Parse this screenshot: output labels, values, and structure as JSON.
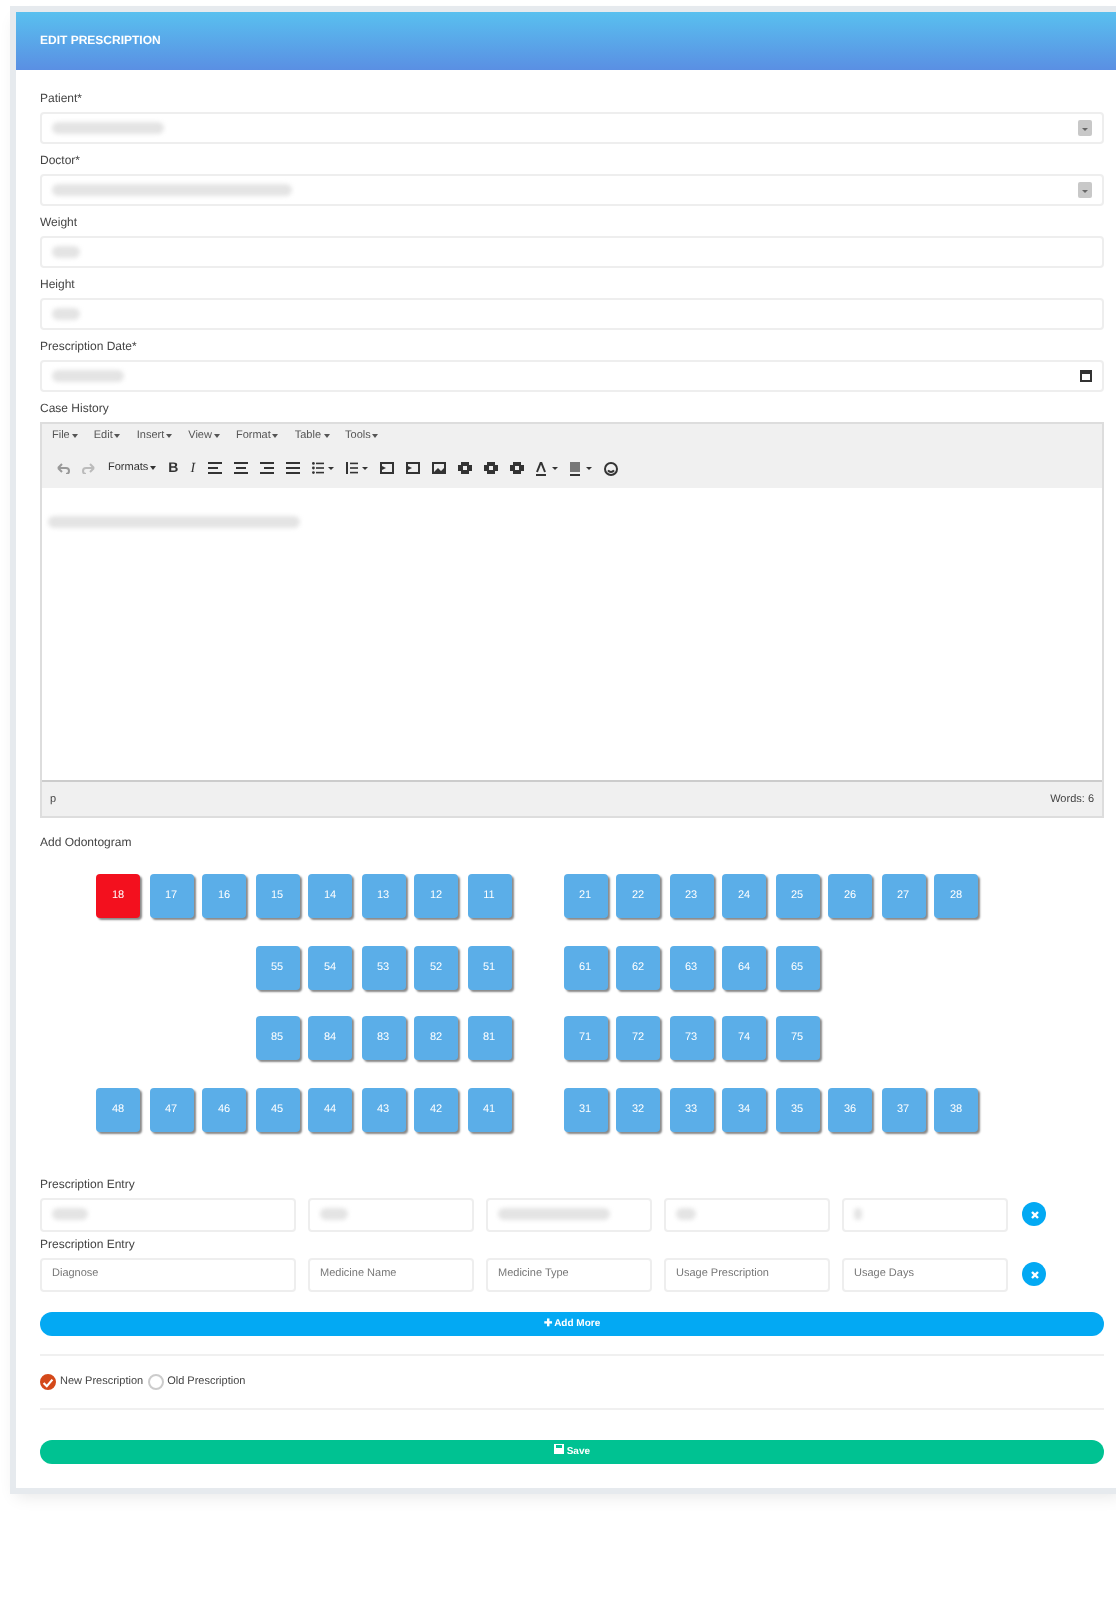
{
  "panel": {
    "title": "EDIT PRESCRIPTION"
  },
  "fields": [
    {
      "label": "Patient*",
      "kind": "select"
    },
    {
      "label": "Doctor*",
      "kind": "select"
    },
    {
      "label": "Weight",
      "kind": "text"
    },
    {
      "label": "Height",
      "kind": "text"
    },
    {
      "label": "Prescription Date*",
      "kind": "date"
    }
  ],
  "editor": {
    "label": "Case History",
    "menus": [
      "File",
      "Edit",
      "Insert",
      "View",
      "Format",
      "Table",
      "Tools"
    ],
    "formats": "Formats",
    "bold": "B",
    "italic": "I",
    "path": "p",
    "word_count": "Words: 6"
  },
  "odontogram": {
    "label": "Add Odontogram",
    "rows": [
      {
        "left": [
          {
            "label": "18",
            "selected": true
          },
          {
            "label": "17",
            "selected": false
          },
          {
            "label": "16",
            "selected": false
          },
          {
            "label": "15",
            "selected": false
          },
          {
            "label": "14",
            "selected": false
          },
          {
            "label": "13",
            "selected": false
          },
          {
            "label": "12",
            "selected": false
          },
          {
            "label": "11",
            "selected": false
          }
        ],
        "right": [
          {
            "label": "21",
            "selected": false
          },
          {
            "label": "22",
            "selected": false
          },
          {
            "label": "23",
            "selected": false
          },
          {
            "label": "24",
            "selected": false
          },
          {
            "label": "25",
            "selected": false
          },
          {
            "label": "26",
            "selected": false
          },
          {
            "label": "27",
            "selected": false
          },
          {
            "label": "28",
            "selected": false
          }
        ]
      },
      {
        "left": [
          {
            "label": "55",
            "selected": false
          },
          {
            "label": "54",
            "selected": false
          },
          {
            "label": "53",
            "selected": false
          },
          {
            "label": "52",
            "selected": false
          },
          {
            "label": "51",
            "selected": false
          }
        ],
        "right": [
          {
            "label": "61",
            "selected": false
          },
          {
            "label": "62",
            "selected": false
          },
          {
            "label": "63",
            "selected": false
          },
          {
            "label": "64",
            "selected": false
          },
          {
            "label": "65",
            "selected": false
          }
        ]
      },
      {
        "left": [
          {
            "label": "85",
            "selected": false
          },
          {
            "label": "84",
            "selected": false
          },
          {
            "label": "83",
            "selected": false
          },
          {
            "label": "82",
            "selected": false
          },
          {
            "label": "81",
            "selected": false
          }
        ],
        "right": [
          {
            "label": "71",
            "selected": false
          },
          {
            "label": "72",
            "selected": false
          },
          {
            "label": "73",
            "selected": false
          },
          {
            "label": "74",
            "selected": false
          },
          {
            "label": "75",
            "selected": false
          }
        ]
      },
      {
        "left": [
          {
            "label": "48",
            "selected": false
          },
          {
            "label": "47",
            "selected": false
          },
          {
            "label": "46",
            "selected": false
          },
          {
            "label": "45",
            "selected": false
          },
          {
            "label": "44",
            "selected": false
          },
          {
            "label": "43",
            "selected": false
          },
          {
            "label": "42",
            "selected": false
          },
          {
            "label": "41",
            "selected": false
          }
        ],
        "right": [
          {
            "label": "31",
            "selected": false
          },
          {
            "label": "32",
            "selected": false
          },
          {
            "label": "33",
            "selected": false
          },
          {
            "label": "34",
            "selected": false
          },
          {
            "label": "35",
            "selected": false
          },
          {
            "label": "36",
            "selected": false
          },
          {
            "label": "37",
            "selected": false
          },
          {
            "label": "38",
            "selected": false
          }
        ]
      }
    ]
  },
  "entries": [
    {
      "label": "Prescription Entry",
      "kind": "filled"
    },
    {
      "label": "Prescription Entry",
      "kind": "blank",
      "placeholders": [
        "Diagnose",
        "Medicine Name",
        "Medicine Type",
        "Usage Prescription",
        "Usage Days"
      ]
    }
  ],
  "add_more": "✚ Add More",
  "options": [
    {
      "label": "New Prescription",
      "selected": true
    },
    {
      "label": "Old Prescription",
      "selected": false
    }
  ],
  "save": "Save"
}
